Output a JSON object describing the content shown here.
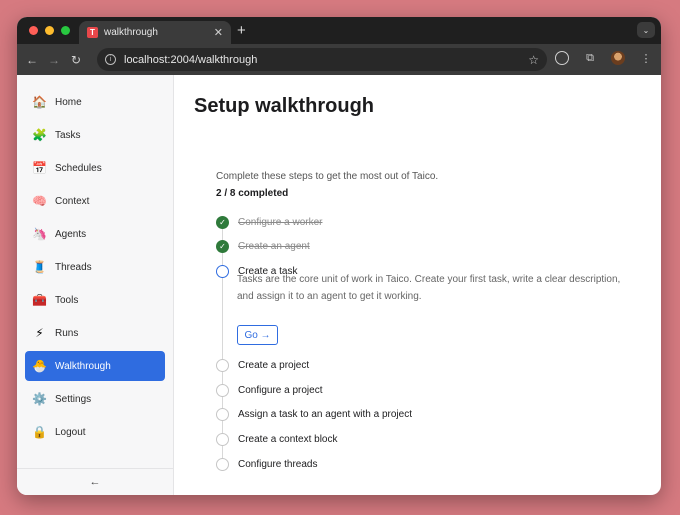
{
  "browser": {
    "tab_title": "walkthrough",
    "favicon_letter": "T",
    "new_tab": "+",
    "tab_close": "✕",
    "tab_menu": "⌄",
    "url": "localhost:2004/walkthrough",
    "back": "←",
    "forward": "→",
    "reload": "↻",
    "site_info": "i",
    "star": "☆",
    "extensions_icon": "⧉",
    "menu_icon": "⋮",
    "colors": {
      "close": "#ff5f57",
      "minimize": "#febc2e",
      "maximize": "#28c840"
    }
  },
  "sidebar": {
    "items": [
      {
        "label": "Home",
        "icon": "house-icon",
        "glyph": "🏠",
        "active": false
      },
      {
        "label": "Tasks",
        "icon": "puzzle-icon",
        "glyph": "🧩",
        "active": false
      },
      {
        "label": "Schedules",
        "icon": "calendar-icon",
        "glyph": "📅",
        "active": false
      },
      {
        "label": "Context",
        "icon": "brain-icon",
        "glyph": "🧠",
        "active": false
      },
      {
        "label": "Agents",
        "icon": "agent-icon",
        "glyph": "🦄",
        "active": false
      },
      {
        "label": "Threads",
        "icon": "thread-spool-icon",
        "glyph": "🧵",
        "active": false
      },
      {
        "label": "Tools",
        "icon": "toolbox-icon",
        "glyph": "🧰",
        "active": false
      },
      {
        "label": "Runs",
        "icon": "lightning-icon",
        "glyph": "⚡",
        "active": false
      },
      {
        "label": "Walkthrough",
        "icon": "hatching-chick-icon",
        "glyph": "🐣",
        "active": true
      },
      {
        "label": "Settings",
        "icon": "gear-icon",
        "glyph": "⚙️",
        "active": false
      },
      {
        "label": "Logout",
        "icon": "lock-icon",
        "glyph": "🔒",
        "active": false
      }
    ],
    "collapse_glyph": "←"
  },
  "main": {
    "title": "Setup walkthrough",
    "intro": "Complete these steps to get the most out of Taico.",
    "progress": "2 / 8 completed",
    "steps": [
      {
        "label": "Configure a worker",
        "status": "done"
      },
      {
        "label": "Create an agent",
        "status": "done"
      },
      {
        "label": "Create a task",
        "status": "current"
      },
      {
        "label": "Create a project",
        "status": "pending"
      },
      {
        "label": "Configure a project",
        "status": "pending"
      },
      {
        "label": "Assign a task to an agent with a project",
        "status": "pending"
      },
      {
        "label": "Create a context block",
        "status": "pending"
      },
      {
        "label": "Configure threads",
        "status": "pending"
      }
    ],
    "current_description": "Tasks are the core unit of work in Taico. Create your first task, write a clear description, and assign it to an agent to get it working.",
    "go_label": "Go →",
    "check_glyph": "✓",
    "colors": {
      "accent": "#2f6ce0",
      "done": "#2f7a3b"
    }
  }
}
